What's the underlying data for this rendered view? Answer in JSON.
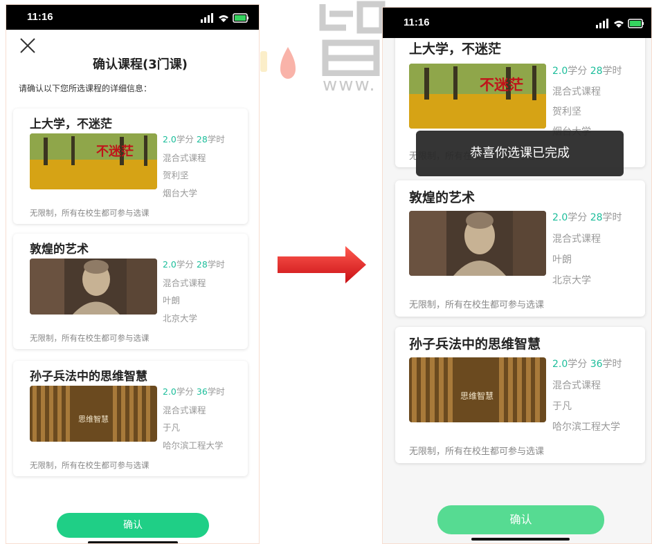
{
  "watermark": {
    "text": "www."
  },
  "status": {
    "time": "11:16"
  },
  "left": {
    "title": "确认课程(3门课)",
    "intro": "请确认以下您所选课程的详细信息：",
    "confirm_label": "确认"
  },
  "right": {
    "toast": "恭喜你选课已完成",
    "confirm_label": "确认"
  },
  "courses": [
    {
      "name": "上大学，不迷茫",
      "credit": "2.0",
      "credit_unit": "学分",
      "hours": "28",
      "hours_unit": "学时",
      "type": "混合式课程",
      "teacher": "贺利坚",
      "school": "烟台大学",
      "restriction": "无限制，所有在校生都可参与选课",
      "thumb_caption": "不迷茫"
    },
    {
      "name": "敦煌的艺术",
      "credit": "2.0",
      "credit_unit": "学分",
      "hours": "28",
      "hours_unit": "学时",
      "type": "混合式课程",
      "teacher": "叶朗",
      "school": "北京大学",
      "restriction": "无限制，所有在校生都可参与选课"
    },
    {
      "name": "孙子兵法中的思维智慧",
      "credit": "2.0",
      "credit_unit": "学分",
      "hours": "36",
      "hours_unit": "学时",
      "type": "混合式课程",
      "teacher": "于凡",
      "school": "哈尔滨工程大学",
      "restriction": "无限制，所有在校生都可参与选课",
      "thumb_caption": "思维智慧"
    }
  ],
  "colors": {
    "accent_green": "#1bbd9a",
    "button_green": "#1fcf86",
    "arrow_red": "#e0191f"
  }
}
